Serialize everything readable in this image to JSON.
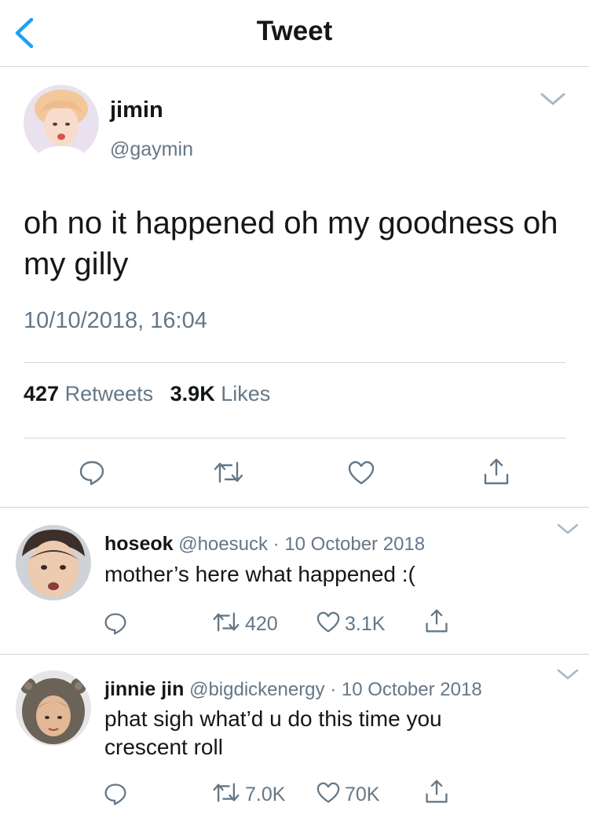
{
  "nav": {
    "title": "Tweet"
  },
  "tweet": {
    "name": "jimin",
    "handle": "@gaymin",
    "text": "oh no it happened oh my goodness oh my gilly",
    "date": "10/10/2018, 16:04",
    "retweets_count": "427",
    "retweets_label": "Retweets",
    "likes_count": "3.9K",
    "likes_label": "Likes"
  },
  "replies": [
    {
      "name": "hoseok",
      "handle": "@hoesuck",
      "separator": "·",
      "date": "10 October 2018",
      "text": "mother’s here what happened :(",
      "retweets": "420",
      "likes": "3.1K"
    },
    {
      "name": "jinnie jin",
      "handle": "@bigdickenergy",
      "separator": "·",
      "date": "10 October 2018",
      "text": "phat sigh what’d u do this time you crescent roll",
      "retweets": "7.0K",
      "likes": "70K"
    }
  ],
  "colors": {
    "accent": "#1da1f2",
    "text": "#14171a",
    "secondary": "#657786",
    "divider": "#d6d6d6"
  },
  "icons": [
    "back-chevron-icon",
    "chevron-down-icon",
    "reply-icon",
    "retweet-icon",
    "heart-icon",
    "share-icon"
  ]
}
